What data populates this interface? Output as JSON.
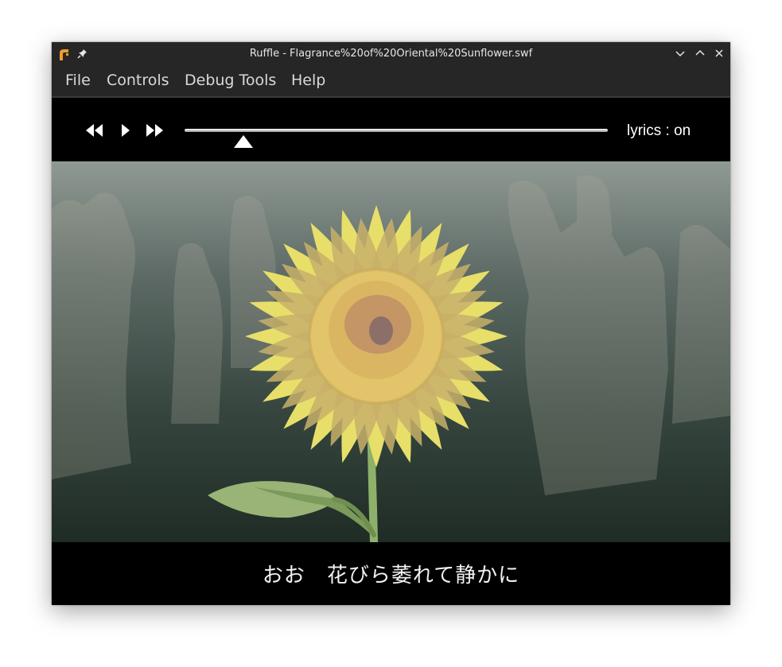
{
  "window": {
    "title": "Ruffle - Flagrance%20of%20Oriental%20Sunflower.swf",
    "app_icon": "ruffle-logo-icon",
    "pin_icon": "pin-icon",
    "window_buttons": [
      "minimize-icon",
      "maximize-icon",
      "close-icon"
    ]
  },
  "menu": {
    "items": [
      "File",
      "Controls",
      "Debug Tools",
      "Help"
    ]
  },
  "player": {
    "rewind_icon": "rewind-icon",
    "play_icon": "play-icon",
    "fast_forward_icon": "fast-forward-icon",
    "seek_progress": 0.14,
    "lyrics_label": "lyrics : on"
  },
  "stage": {
    "scene": "sunflower-illustration",
    "subtitle": "おお　花びら萎れて静かに"
  },
  "colors": {
    "titlebar": "#262626",
    "petal": "#e7df6a",
    "seed_disc": "#e2c56a",
    "leaf": "#8fb06a"
  }
}
